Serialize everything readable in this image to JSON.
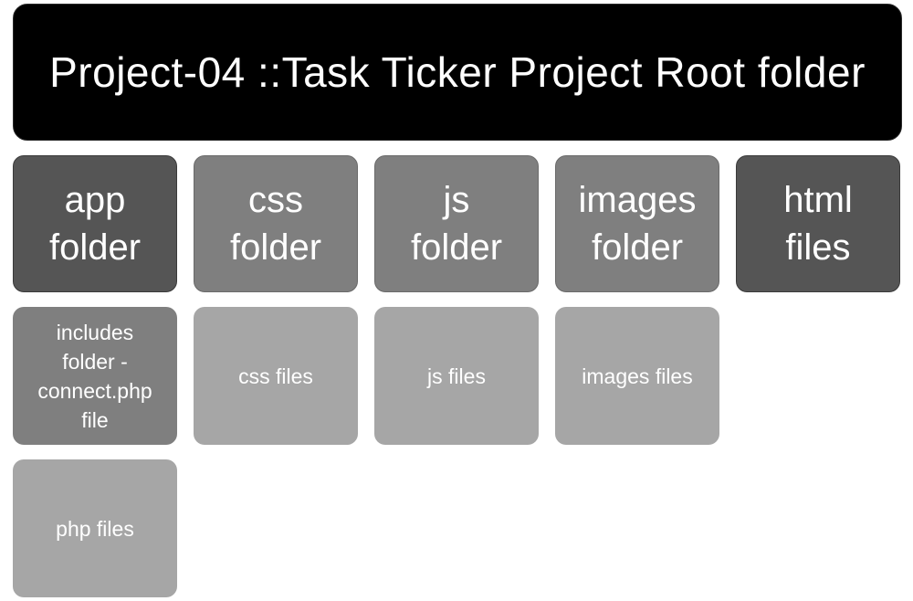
{
  "root": {
    "label": "Project-04 ::Task Ticker Project Root folder"
  },
  "level1": [
    {
      "label": "app\nfolder",
      "color": "#555555"
    },
    {
      "label": "css\nfolder",
      "color": "#7f7f7f"
    },
    {
      "label": "js\nfolder",
      "color": "#7f7f7f"
    },
    {
      "label": "images\nfolder",
      "color": "#7f7f7f"
    },
    {
      "label": "html\nfiles",
      "color": "#555555"
    }
  ],
  "level2": [
    {
      "label": "includes\nfolder -\nconnect.php\nfile",
      "color": "#7f7f7f"
    },
    {
      "label": "css files",
      "color": "#a6a6a6"
    },
    {
      "label": "js files",
      "color": "#a6a6a6"
    },
    {
      "label": "images files",
      "color": "#a6a6a6"
    }
  ],
  "level3": [
    {
      "label": "php files",
      "color": "#a6a6a6"
    }
  ]
}
